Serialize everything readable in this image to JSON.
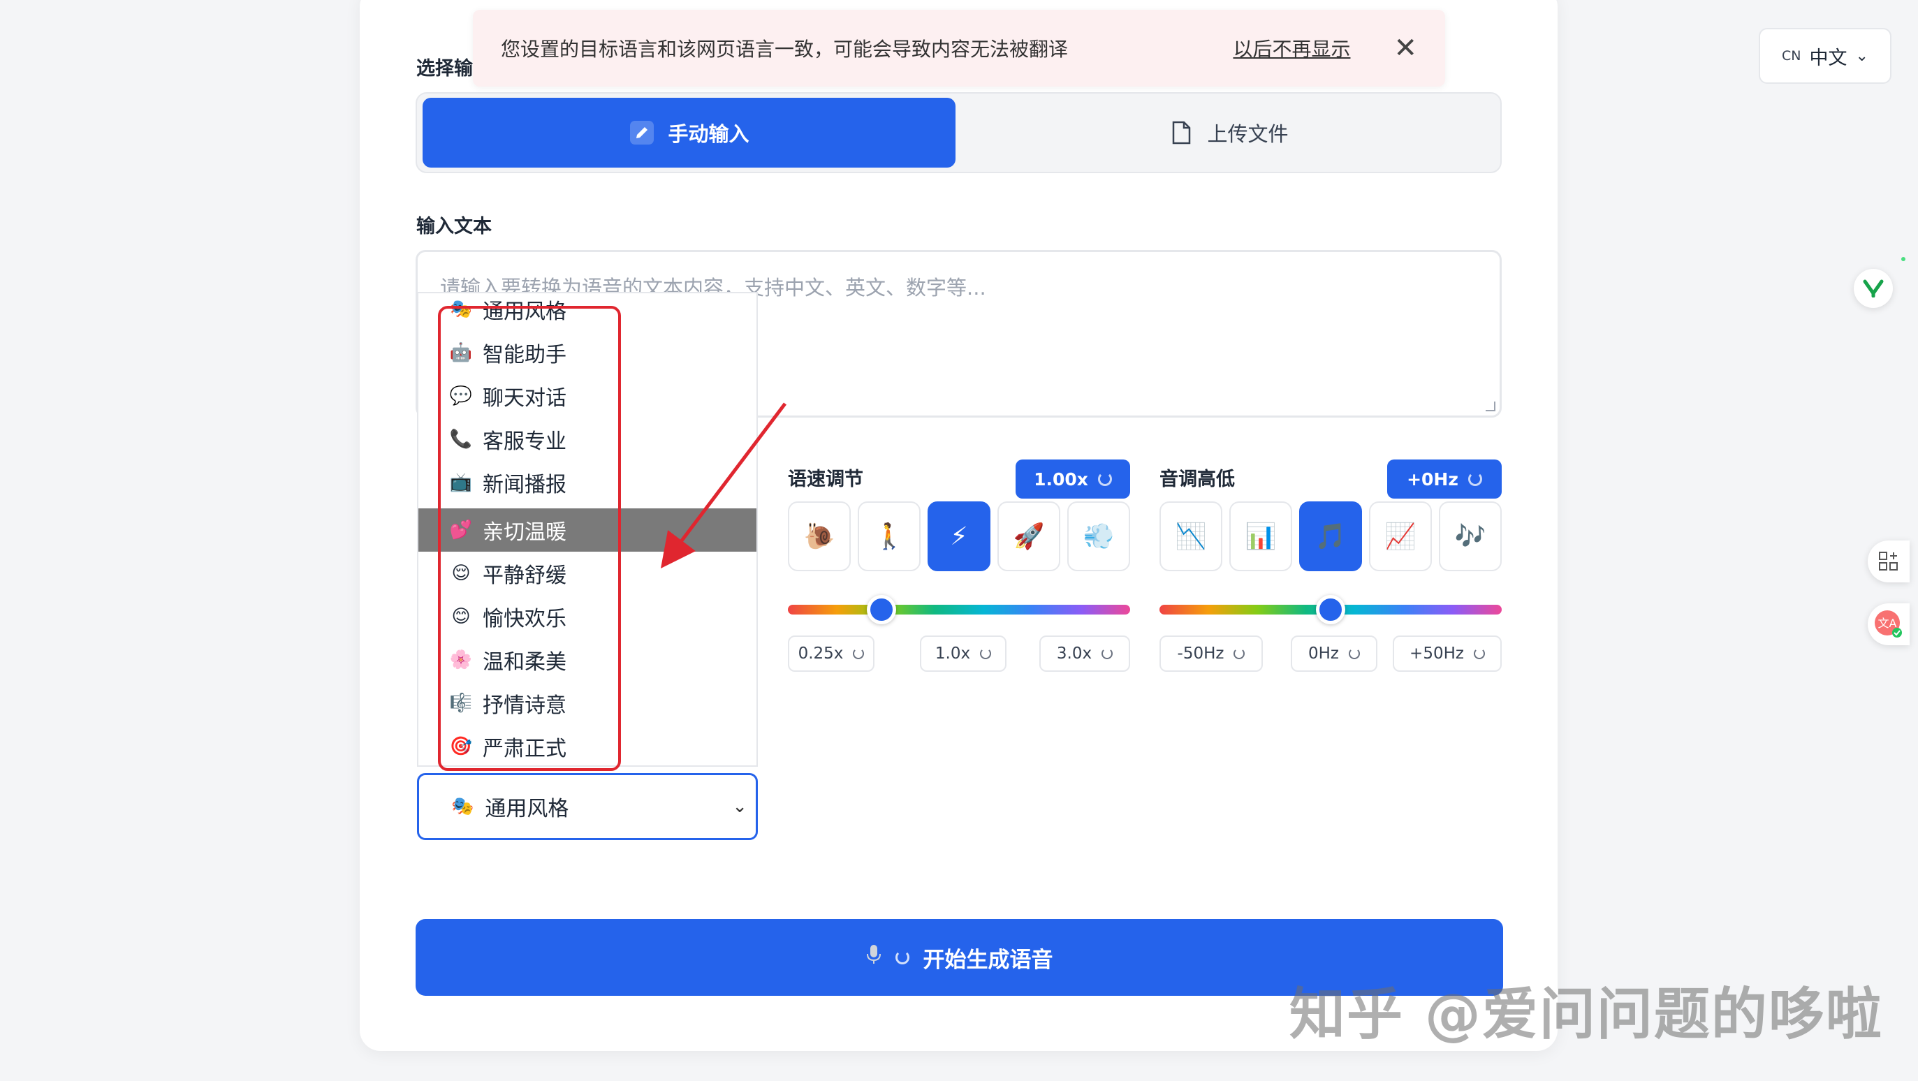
{
  "toast": {
    "message": "您设置的目标语言和该网页语言一致，可能会导致内容无法被翻译",
    "dismiss_label": "以后不再显示",
    "close_glyph": "✕"
  },
  "input_section": {
    "label": "选择输",
    "tabs": [
      {
        "label": "手动输入",
        "icon": "pencil-icon",
        "active": true
      },
      {
        "label": "上传文件",
        "icon": "file-icon",
        "active": false
      }
    ]
  },
  "text_section": {
    "label": "输入文本",
    "placeholder": "请输入要转换为语音的文本内容，支持中文、英文、数字等..."
  },
  "style_dropdown": {
    "items": [
      {
        "emoji": "🎭",
        "label": "通用风格"
      },
      {
        "emoji": "🤖",
        "label": "智能助手"
      },
      {
        "emoji": "💬",
        "label": "聊天对话"
      },
      {
        "emoji": "📞",
        "label": "客服专业"
      },
      {
        "emoji": "📺",
        "label": "新闻播报"
      },
      {
        "emoji": "💕",
        "label": "亲切温暖"
      },
      {
        "emoji": "😌",
        "label": "平静舒缓"
      },
      {
        "emoji": "😊",
        "label": "愉快欢乐"
      },
      {
        "emoji": "🌸",
        "label": "温和柔美"
      },
      {
        "emoji": "🎼",
        "label": "抒情诗意"
      },
      {
        "emoji": "🎯",
        "label": "严肃正式"
      }
    ],
    "highlighted_index": 5,
    "selected": {
      "emoji": "🎭",
      "label": "通用风格"
    }
  },
  "speed": {
    "label": "语速调节",
    "value": "1.00x",
    "value_number": 1.0,
    "min": 0.25,
    "max": 3.0,
    "buttons": [
      "🐌",
      "🚶",
      "⚡",
      "🚀",
      "💨"
    ],
    "selected_button": 2,
    "presets": [
      "0.25x",
      "1.0x",
      "3.0x"
    ]
  },
  "pitch": {
    "label": "音调高低",
    "value": "+0Hz",
    "value_number": 0,
    "min": -50,
    "max": 50,
    "buttons": [
      "📉",
      "📊",
      "🎵",
      "📈",
      "🎶"
    ],
    "selected_button": 2,
    "presets": [
      "-50Hz",
      "0Hz",
      "+50Hz"
    ]
  },
  "generate": {
    "label": "开始生成语音",
    "icon": "microphone-icon"
  },
  "language": {
    "code": "CN",
    "label": "中文"
  },
  "watermark": "知乎 @爱问问题的哆啦",
  "colors": {
    "primary": "#2563eb",
    "highlight": "#e0262f",
    "toast_bg": "#fdf0f1"
  }
}
